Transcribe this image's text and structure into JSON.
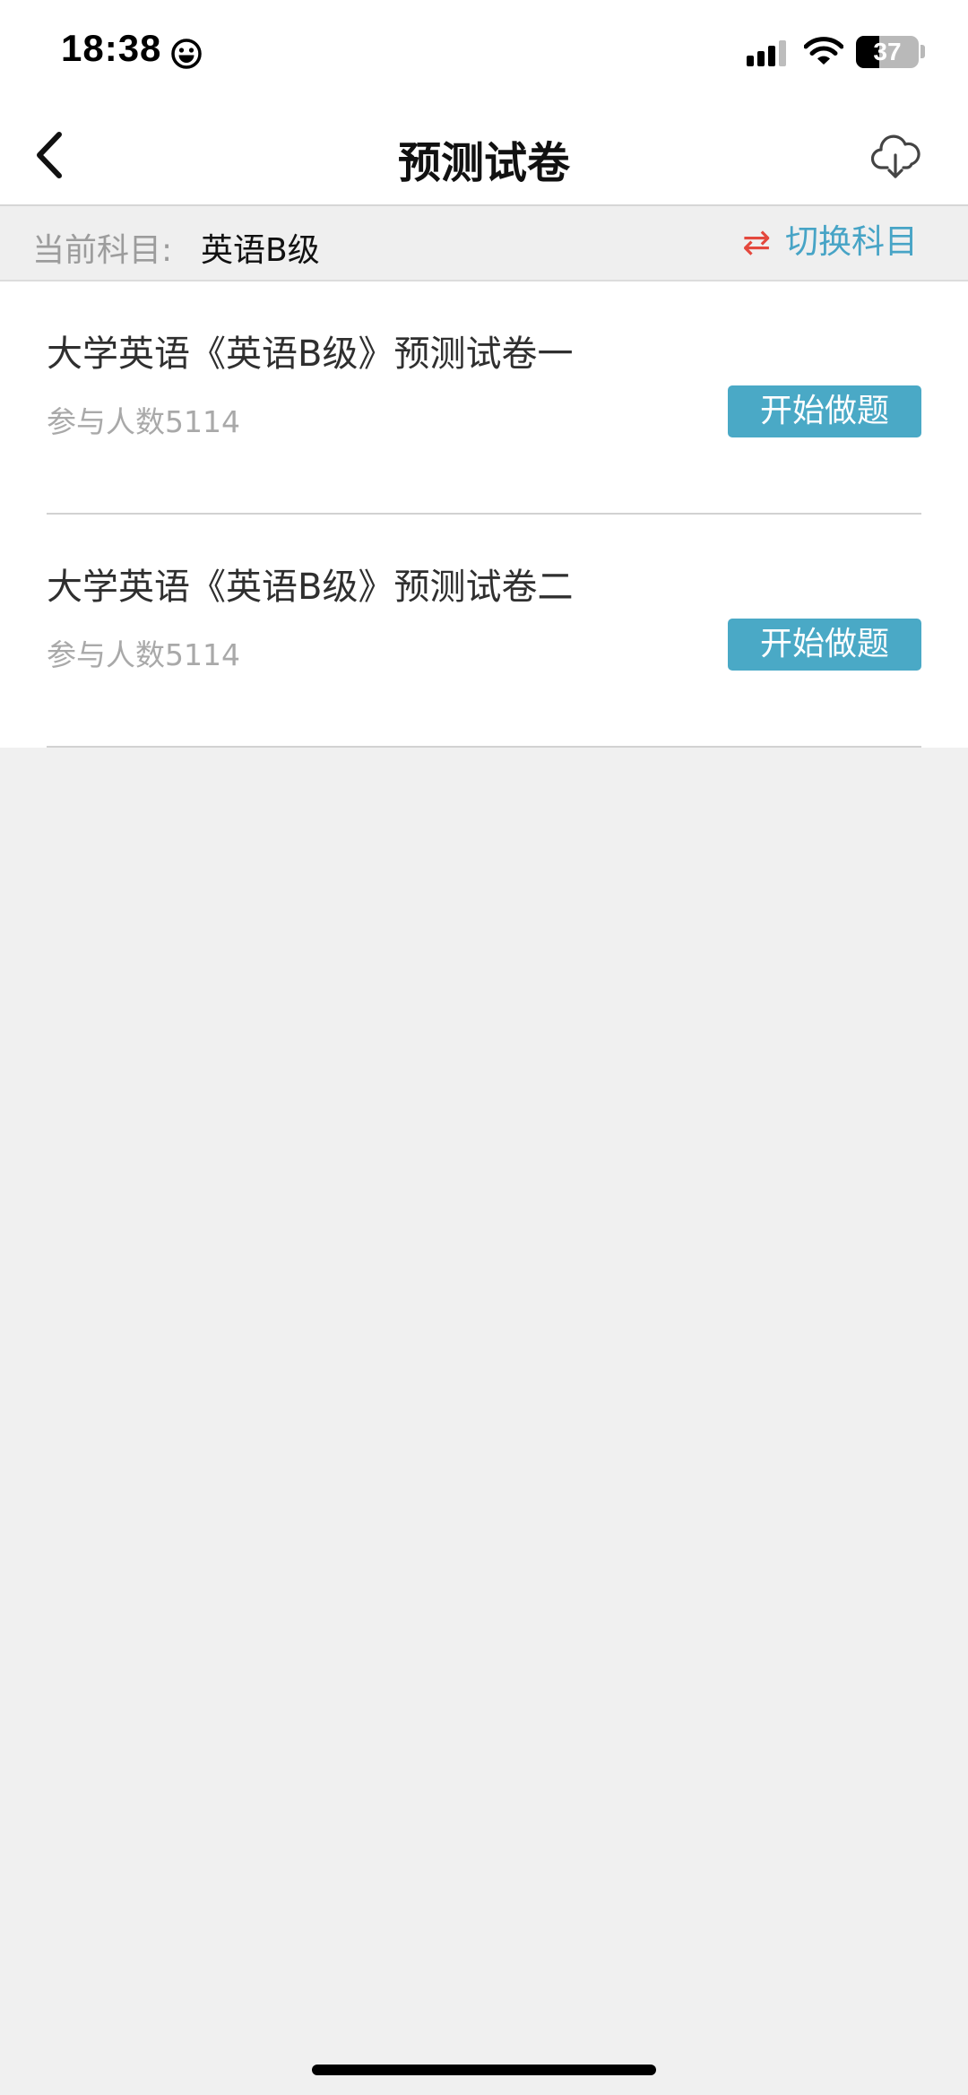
{
  "status_bar": {
    "time": "18:38",
    "battery_level": "37"
  },
  "nav": {
    "title": "预测试卷"
  },
  "subject": {
    "label": "当前科目:",
    "value": "英语B级",
    "switch_icon": "⇄",
    "switch_label": "切换科目"
  },
  "papers": [
    {
      "title": "大学英语《英语B级》预测试卷一",
      "participants": "参与人数5114",
      "action": "开始做题"
    },
    {
      "title": "大学英语《英语B级》预测试卷二",
      "participants": "参与人数5114",
      "action": "开始做题"
    }
  ],
  "colors": {
    "accent": "#4aa9c6",
    "switch_icon": "#e4483d",
    "background": "#f0f0f0"
  }
}
